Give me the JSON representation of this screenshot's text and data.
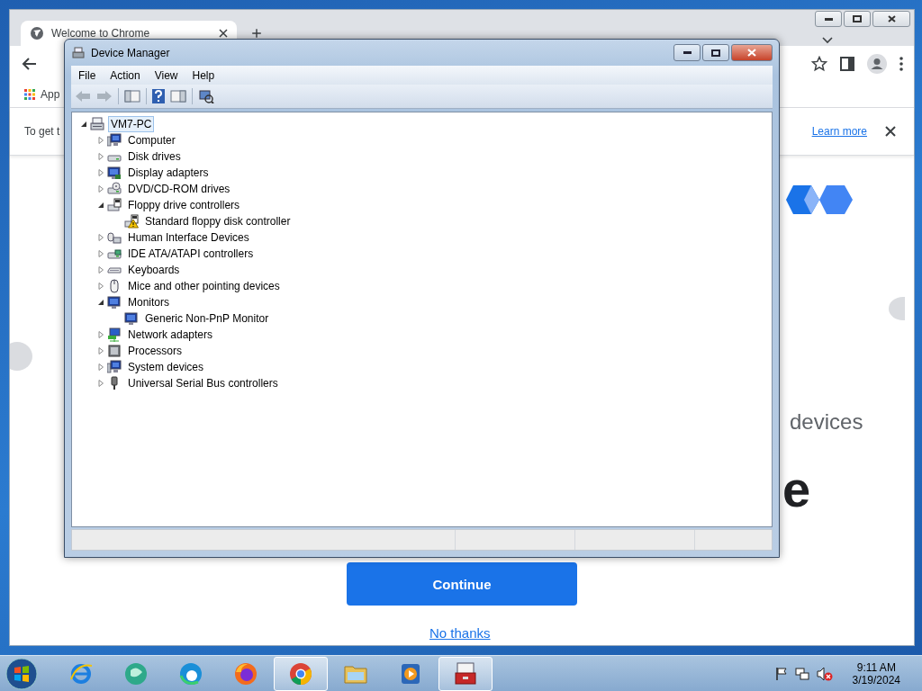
{
  "browser": {
    "tab": {
      "title": "Welcome to Chrome"
    },
    "bookmarks": [
      {
        "label": "App"
      }
    ],
    "infobar": {
      "text": "To get t",
      "link": "Learn more"
    },
    "page": {
      "heading_fragment": "devices",
      "title_fragment": "e",
      "primary_button": "Continue",
      "secondary_link": "No thanks"
    }
  },
  "device_manager": {
    "title": "Device Manager",
    "menu": [
      "File",
      "Action",
      "View",
      "Help"
    ],
    "tree": {
      "label": "VM7-PC",
      "kind": "pc",
      "selected": true,
      "expanded": true,
      "children": [
        {
          "label": "Computer",
          "kind": "computer",
          "selected": false,
          "expanded": false
        },
        {
          "label": "Disk drives",
          "kind": "drive",
          "selected": false,
          "expanded": false
        },
        {
          "label": "Display adapters",
          "kind": "display",
          "selected": false,
          "expanded": false
        },
        {
          "label": "DVD/CD-ROM drives",
          "kind": "dvd",
          "selected": false,
          "expanded": false
        },
        {
          "label": "Floppy drive controllers",
          "kind": "floppy",
          "selected": false,
          "expanded": true,
          "children": [
            {
              "label": "Standard floppy disk controller",
              "kind": "floppy-warning",
              "selected": false
            }
          ]
        },
        {
          "label": "Human Interface Devices",
          "kind": "hid",
          "selected": false,
          "expanded": false
        },
        {
          "label": "IDE ATA/ATAPI controllers",
          "kind": "ide",
          "selected": false,
          "expanded": false
        },
        {
          "label": "Keyboards",
          "kind": "keyboard",
          "selected": false,
          "expanded": false
        },
        {
          "label": "Mice and other pointing devices",
          "kind": "mouse",
          "selected": false,
          "expanded": false
        },
        {
          "label": "Monitors",
          "kind": "monitor",
          "selected": false,
          "expanded": true,
          "children": [
            {
              "label": "Generic Non-PnP Monitor",
              "kind": "monitor",
              "selected": false
            }
          ]
        },
        {
          "label": "Network adapters",
          "kind": "network",
          "selected": false,
          "expanded": false
        },
        {
          "label": "Processors",
          "kind": "chip",
          "selected": false,
          "expanded": false
        },
        {
          "label": "System devices",
          "kind": "computer",
          "selected": false,
          "expanded": false
        },
        {
          "label": "Universal Serial Bus controllers",
          "kind": "usb",
          "selected": false,
          "expanded": false
        }
      ]
    }
  },
  "taskbar": {
    "apps": [
      {
        "kind": "ie",
        "active": false
      },
      {
        "kind": "green",
        "active": false
      },
      {
        "kind": "edge",
        "active": false
      },
      {
        "kind": "firefox",
        "active": false
      },
      {
        "kind": "chrome",
        "active": true
      },
      {
        "kind": "folder",
        "active": false
      },
      {
        "kind": "media",
        "active": false
      },
      {
        "kind": "toolbox",
        "active": true
      }
    ],
    "clock": {
      "time": "9:11 AM",
      "date": "3/19/2024"
    }
  }
}
